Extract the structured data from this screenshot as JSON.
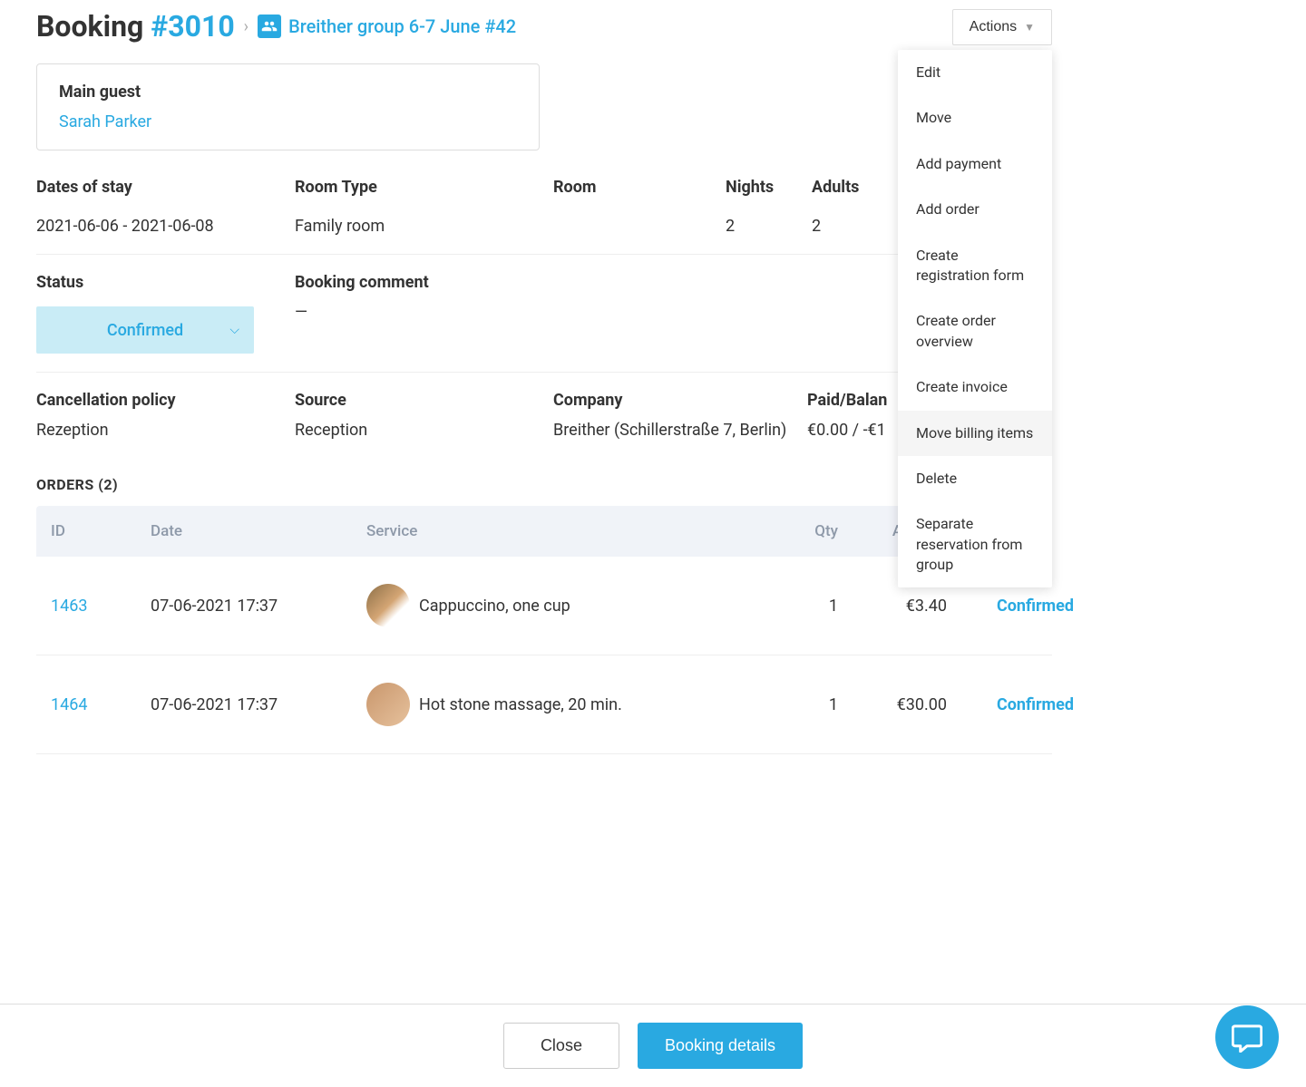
{
  "header": {
    "title_prefix": "Booking",
    "title_number": "#3010",
    "group_link": "Breither group 6-7 June #42",
    "actions_label": "Actions"
  },
  "actions_menu": {
    "edit": "Edit",
    "move": "Move",
    "add_payment": "Add payment",
    "add_order": "Add order",
    "create_reg": "Create registration form",
    "create_overview": "Create order overview",
    "create_invoice": "Create invoice",
    "move_billing": "Move billing items",
    "delete": "Delete",
    "separate": "Separate reservation from group"
  },
  "guest_card": {
    "title": "Main guest",
    "name": "Sarah Parker"
  },
  "details": {
    "dates_label": "Dates of stay",
    "dates_value": "2021-06-06 - 2021-06-08",
    "roomtype_label": "Room Type",
    "roomtype_value": "Family room",
    "room_label": "Room",
    "room_value": "",
    "nights_label": "Nights",
    "nights_value": "2",
    "adults_label": "Adults",
    "adults_value": "2"
  },
  "status_section": {
    "status_label": "Status",
    "status_value": "Confirmed",
    "comment_label": "Booking comment",
    "comment_value": "—"
  },
  "info_section": {
    "cancellation_label": "Cancellation policy",
    "cancellation_value": "Rezeption",
    "source_label": "Source",
    "source_value": "Reception",
    "company_label": "Company",
    "company_value": "Breither (Schillerstraße 7, Berlin)",
    "paid_label": "Paid/Balan",
    "paid_value": "€0.00 / -€1"
  },
  "orders": {
    "title": "ORDERS (2)",
    "columns": {
      "id": "ID",
      "date": "Date",
      "service": "Service",
      "qty": "Qty",
      "amount": "Amount"
    },
    "rows": [
      {
        "id": "1463",
        "date": "07-06-2021 17:37",
        "service": "Cappuccino, one cup",
        "qty": "1",
        "amount": "€3.40",
        "status": "Confirmed"
      },
      {
        "id": "1464",
        "date": "07-06-2021 17:37",
        "service": "Hot stone massage, 20 min.",
        "qty": "1",
        "amount": "€30.00",
        "status": "Confirmed"
      }
    ]
  },
  "footer": {
    "close": "Close",
    "details": "Booking details"
  }
}
